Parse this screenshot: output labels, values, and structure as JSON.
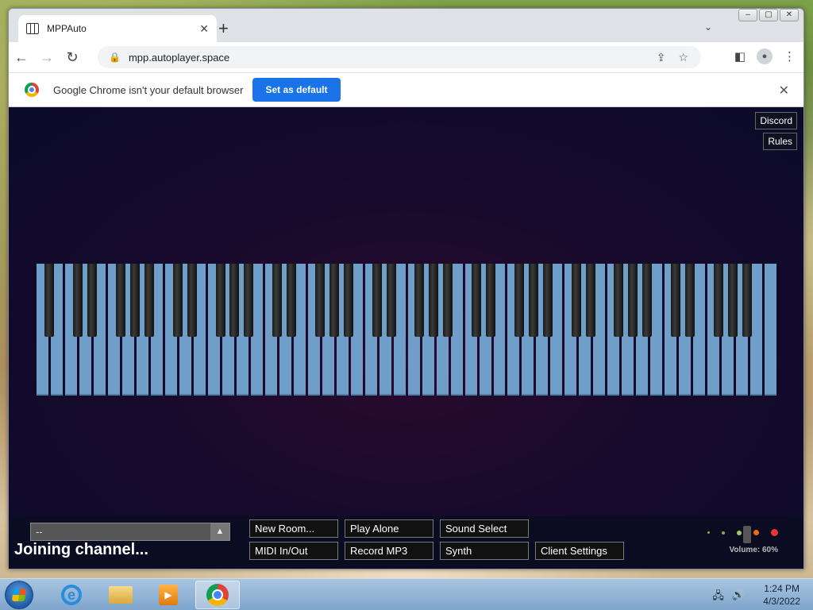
{
  "browser": {
    "tab_title": "MPPAuto",
    "tab_close": "✕",
    "new_tab": "+",
    "url": "mpp.autoplayer.space",
    "infobar_text": "Google Chrome isn't your default browser",
    "set_default_label": "Set as default",
    "infobar_close": "✕"
  },
  "page": {
    "discord_label": "Discord",
    "rules_label": "Rules",
    "channel_value": "--",
    "status_text": "Joining channel...",
    "buttons": {
      "new_room": "New Room...",
      "play_alone": "Play Alone",
      "sound_select": "Sound Select",
      "midi": "MIDI In/Out",
      "record_mp3": "Record MP3",
      "synth": "Synth",
      "client_settings": "Client Settings"
    },
    "volume_label": "Volume: 60%",
    "volume": 0.6
  },
  "taskbar": {
    "time": "1:24 PM",
    "date": "4/3/2022"
  },
  "colors": {
    "white_key": "#6f9fc8",
    "black_key": "#1a1a1a",
    "page_background": "#180a2c",
    "accent": "#1a73e8"
  }
}
